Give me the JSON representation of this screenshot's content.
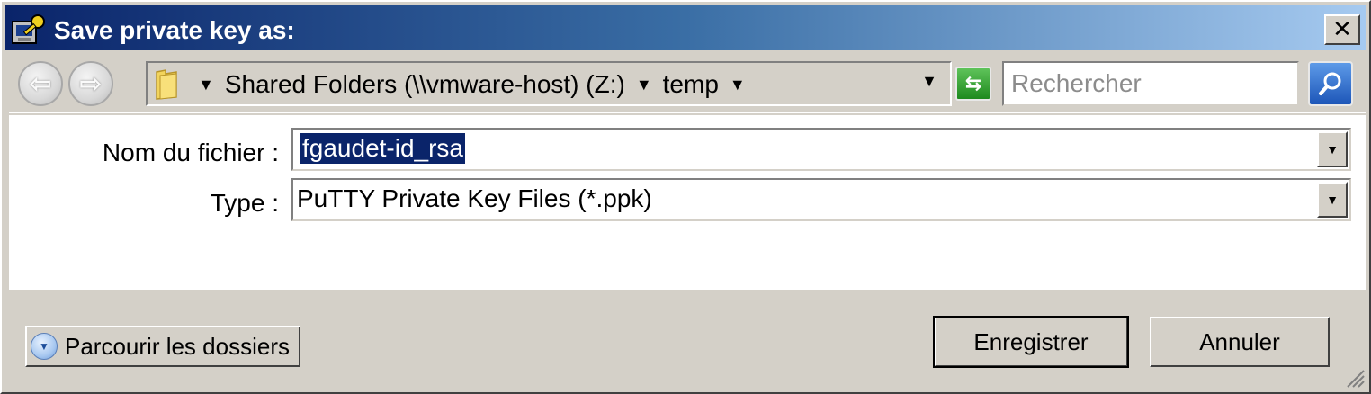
{
  "window": {
    "title": "Save private key as:",
    "close_label": "✕"
  },
  "navbar": {
    "breadcrumbs": [
      "Shared Folders (\\\\vmware-host) (Z:)",
      "temp"
    ],
    "search_placeholder": "Rechercher"
  },
  "form": {
    "filename_label": "Nom du fichier :",
    "filename_value": "fgaudet-id_rsa",
    "type_label": "Type :",
    "type_value": "PuTTY Private Key Files (*.ppk)"
  },
  "footer": {
    "browse_label": "Parcourir les dossiers",
    "save_label": "Enregistrer",
    "cancel_label": "Annuler"
  },
  "colors": {
    "titlebar_start": "#0a246a",
    "titlebar_end": "#a6caf0",
    "selection": "#0a246a",
    "face": "#d4d0c8"
  }
}
